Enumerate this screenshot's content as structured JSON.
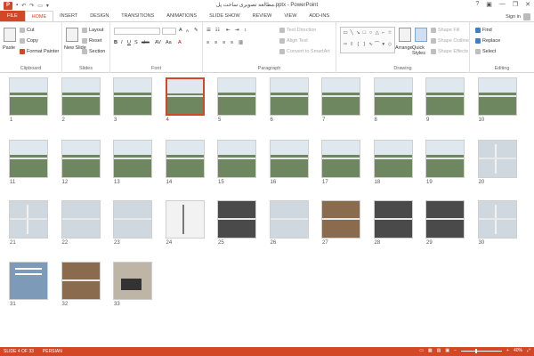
{
  "window": {
    "title": "مطالعه تصویری ساخت پل.pptx - PowerPoint",
    "app_icon": "P",
    "minimize": "—",
    "restore": "❐",
    "close": "✕"
  },
  "quick_access": [
    "save-icon",
    "undo-icon",
    "redo-icon",
    "start-presentation-icon",
    "customize-icon"
  ],
  "tabs": [
    {
      "label": "FILE"
    },
    {
      "label": "HOME"
    },
    {
      "label": "INSERT"
    },
    {
      "label": "DESIGN"
    },
    {
      "label": "TRANSITIONS"
    },
    {
      "label": "ANIMATIONS"
    },
    {
      "label": "SLIDE SHOW"
    },
    {
      "label": "REVIEW"
    },
    {
      "label": "VIEW"
    },
    {
      "label": "ADD-INS"
    }
  ],
  "account": {
    "signin": "Sign in"
  },
  "ribbon": {
    "clipboard": {
      "label": "Clipboard",
      "paste": "Paste",
      "cut": "Cut",
      "copy": "Copy",
      "format_painter": "Format Painter"
    },
    "slides": {
      "label": "Slides",
      "new_slide": "New Slide",
      "layout": "Layout",
      "reset": "Reset",
      "section": "Section"
    },
    "font": {
      "label": "Font",
      "bold": "B",
      "italic": "I",
      "underline": "U",
      "shadow": "S",
      "strike": "abc",
      "aa": "Aa",
      "grow": "A",
      "shrink": "A"
    },
    "paragraph": {
      "label": "Paragraph",
      "text_direction": "Text Direction",
      "align_text": "Align Text",
      "convert_smartart": "Convert to SmartArt"
    },
    "drawing": {
      "label": "Drawing",
      "arrange": "Arrange",
      "quick_styles": "Quick Styles",
      "shape_fill": "Shape Fill",
      "shape_outline": "Shape Outline",
      "shape_effects": "Shape Effects"
    },
    "editing": {
      "label": "Editing",
      "find": "Find",
      "replace": "Replace",
      "select": "Select"
    }
  },
  "slides": [
    {
      "n": "1",
      "kind": "valley"
    },
    {
      "n": "2",
      "kind": "valley"
    },
    {
      "n": "3",
      "kind": "valley"
    },
    {
      "n": "4",
      "kind": "valley",
      "selected": true
    },
    {
      "n": "5",
      "kind": "valley"
    },
    {
      "n": "6",
      "kind": "valley"
    },
    {
      "n": "7",
      "kind": "valley"
    },
    {
      "n": "8",
      "kind": "valley"
    },
    {
      "n": "9",
      "kind": "valley"
    },
    {
      "n": "10",
      "kind": "valley"
    },
    {
      "n": "11",
      "kind": "valley"
    },
    {
      "n": "12",
      "kind": "valley"
    },
    {
      "n": "13",
      "kind": "valley"
    },
    {
      "n": "14",
      "kind": "valley"
    },
    {
      "n": "15",
      "kind": "valley"
    },
    {
      "n": "16",
      "kind": "valley"
    },
    {
      "n": "17",
      "kind": "valley"
    },
    {
      "n": "18",
      "kind": "valley"
    },
    {
      "n": "19",
      "kind": "valley"
    },
    {
      "n": "20",
      "kind": "mast"
    },
    {
      "n": "21",
      "kind": "mast"
    },
    {
      "n": "22",
      "kind": "mist"
    },
    {
      "n": "23",
      "kind": "mist"
    },
    {
      "n": "24",
      "kind": "white"
    },
    {
      "n": "25",
      "kind": "dark"
    },
    {
      "n": "26",
      "kind": "mist"
    },
    {
      "n": "27",
      "kind": "warm"
    },
    {
      "n": "28",
      "kind": "dark"
    },
    {
      "n": "29",
      "kind": "dark"
    },
    {
      "n": "30",
      "kind": "mast"
    },
    {
      "n": "31",
      "kind": "text"
    },
    {
      "n": "32",
      "kind": "warm"
    },
    {
      "n": "33",
      "kind": "laptop"
    }
  ],
  "status": {
    "slide_counter": "SLIDE 4 OF 33",
    "language": "PERSIAN",
    "zoom": "40%"
  },
  "colors": {
    "accent": "#d24726"
  }
}
